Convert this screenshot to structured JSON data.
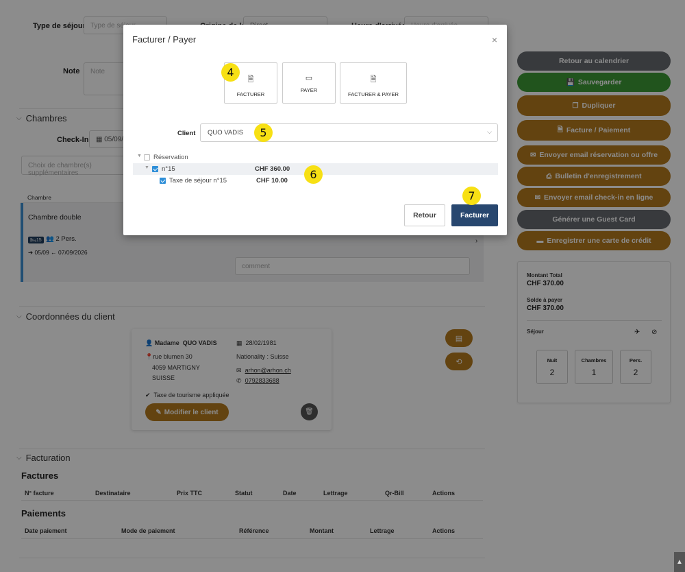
{
  "top_form": {
    "type_label": "Type de séjour",
    "type_placeholder": "Type de séjour",
    "origin_label": "Origine de la",
    "origin_value": "Direct",
    "arrival_label": "Heure d'arrivée",
    "arrival_placeholder": "Heure d'arrivée",
    "note_label": "Note",
    "note_placeholder": "Note"
  },
  "rooms_section": {
    "title": "Chambres",
    "checkin_label": "Check-In",
    "checkin_value": "05/09/",
    "choose_placeholder": "Choix de chambre(s) supplémentaires",
    "col_header": "Chambre",
    "room_name": "Chambre double",
    "bed_badge": "15",
    "persons": "2 Pers.",
    "dates": "05/09",
    "dates_end": "07/09/2026",
    "comment_placeholder": "comment"
  },
  "client_section": {
    "title": "Coordonnées du client",
    "civility": "Madame",
    "name": "QUO VADIS",
    "street": "rue blumen 30",
    "city": "4059 MARTIGNY",
    "country": "SUISSE",
    "birthdate": "28/02/1981",
    "nationality": "Nationality : Suisse",
    "email": "arhon@arhon.ch",
    "phone": "0792833688",
    "tax_note": "Taxe de tourisme appliquée",
    "modify_button": "Modifier le client"
  },
  "billing_section": {
    "title": "Facturation",
    "invoices_title": "Factures",
    "invoice_headers": [
      "N° facture",
      "Destinataire",
      "Prix TTC",
      "Statut",
      "Date",
      "Lettrage",
      "Qr-Bill",
      "Actions"
    ],
    "payments_title": "Paiements",
    "payment_headers": [
      "Date paiement",
      "Mode de paiement",
      "Référence",
      "Montant",
      "Lettrage",
      "Actions"
    ]
  },
  "sidebar": {
    "buttons": [
      {
        "label": "Retour au calendrier",
        "style": "gray",
        "icon": ""
      },
      {
        "label": "Sauvegarder",
        "style": "green",
        "icon": "save-icon"
      },
      {
        "label": "Dupliquer",
        "style": "brown",
        "icon": "copy-icon"
      },
      {
        "label": "Facture / Paiement",
        "style": "brown",
        "icon": "file-icon"
      },
      {
        "label": "Envoyer email réservation ou offre",
        "style": "brown",
        "icon": "envelope-icon"
      },
      {
        "label": "Bulletin d'enregistrement",
        "style": "brown",
        "icon": "printer-icon"
      },
      {
        "label": "Envoyer email check-in en ligne",
        "style": "brown",
        "icon": "envelope-icon"
      },
      {
        "label": "Générer une Guest Card",
        "style": "gray",
        "icon": ""
      },
      {
        "label": "Enregistrer une carte de crédit",
        "style": "brown",
        "icon": "credit-card-icon"
      }
    ],
    "total_label": "Montant Total",
    "total_value": "CHF 370.00",
    "balance_label": "Solde à payer",
    "balance_value": "CHF 370.00",
    "stay_label": "Séjour",
    "stats": [
      {
        "label": "Nuit",
        "value": "2"
      },
      {
        "label": "Chambres",
        "value": "1"
      },
      {
        "label": "Pers.",
        "value": "2"
      }
    ]
  },
  "modal": {
    "title": "Facturer / Payer",
    "options": [
      {
        "label": "FACTURER",
        "icon": "file-icon"
      },
      {
        "label": "PAYER",
        "icon": "credit-card-icon"
      },
      {
        "label": "FACTURER & PAYER",
        "icon": "file-icon"
      }
    ],
    "client_label": "Client",
    "client_value": "QUO VADIS",
    "tree": {
      "root": "Réservation",
      "item": "n°15",
      "item_amount": "CHF 360.00",
      "sub_item": "Taxe de séjour n°15",
      "sub_amount": "CHF 10.00"
    },
    "back_button": "Retour",
    "submit_button": "Facturer"
  },
  "badges": [
    "4",
    "5",
    "6",
    "7"
  ]
}
